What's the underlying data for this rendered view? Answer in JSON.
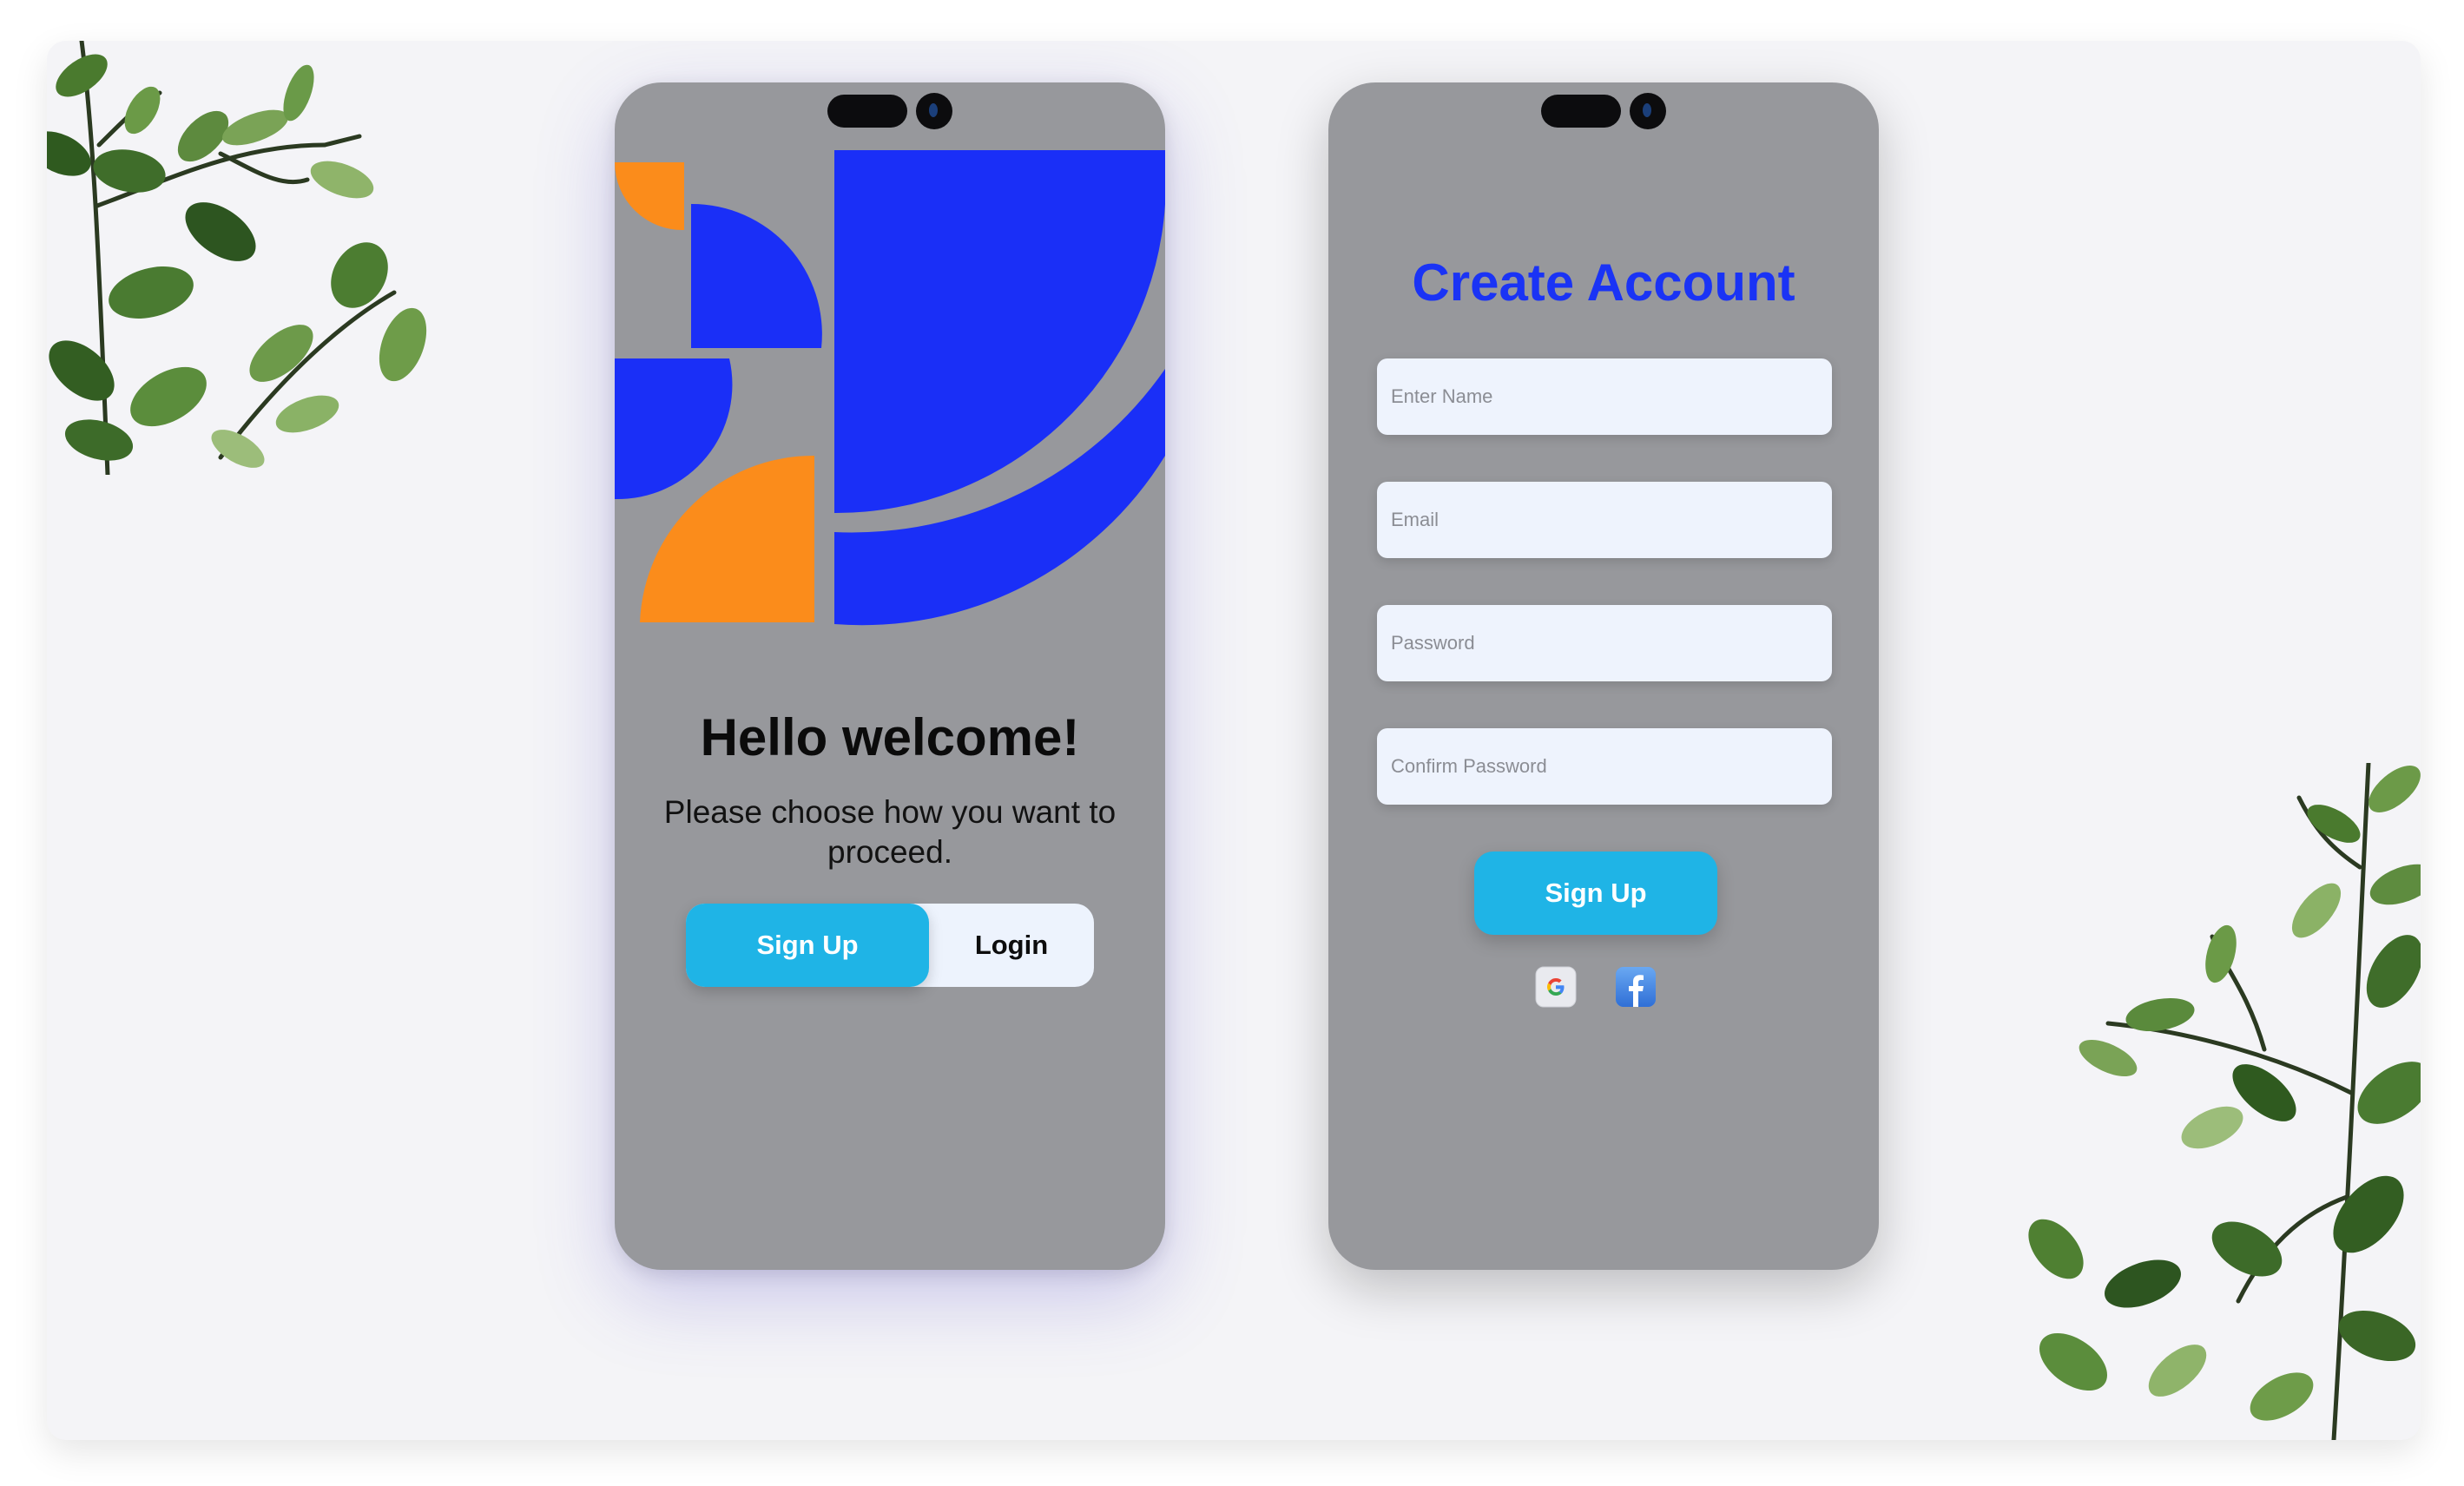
{
  "welcome_screen": {
    "title": "Hello welcome!",
    "subtitle": "Please choose how you want to proceed.",
    "signup_label": "Sign Up",
    "login_label": "Login"
  },
  "signup_screen": {
    "title": "Create Account",
    "fields": {
      "name_placeholder": "Enter Name",
      "email_placeholder": "Email",
      "password_placeholder": "Password",
      "confirm_placeholder": "Confirm Password"
    },
    "signup_label": "Sign Up",
    "social": [
      "google-icon",
      "facebook-icon"
    ]
  },
  "colors": {
    "primary_blue": "#1a33f5",
    "accent_orange": "#fb8c1b",
    "button_cyan": "#1fb4e6",
    "phone_gray": "#97989c",
    "field_bg": "#eef3fd"
  }
}
